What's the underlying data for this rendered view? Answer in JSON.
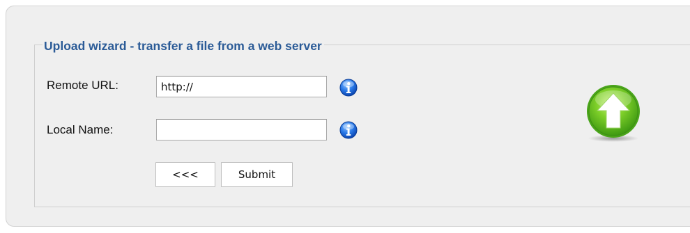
{
  "wizard": {
    "title": "Upload wizard - transfer a file from a web server",
    "remote_url_label": "Remote URL:",
    "remote_url_value": "http://",
    "local_name_label": "Local Name:",
    "local_name_value": "",
    "back_label": "<<<",
    "submit_label": "Submit"
  },
  "icons": {
    "info": "info-icon",
    "upload": "upload-arrow-icon"
  },
  "colors": {
    "title": "#2b5b97",
    "panel_background": "#efefef",
    "info_blue": "#1f6fe0",
    "upload_green": "#5bbf1f"
  }
}
